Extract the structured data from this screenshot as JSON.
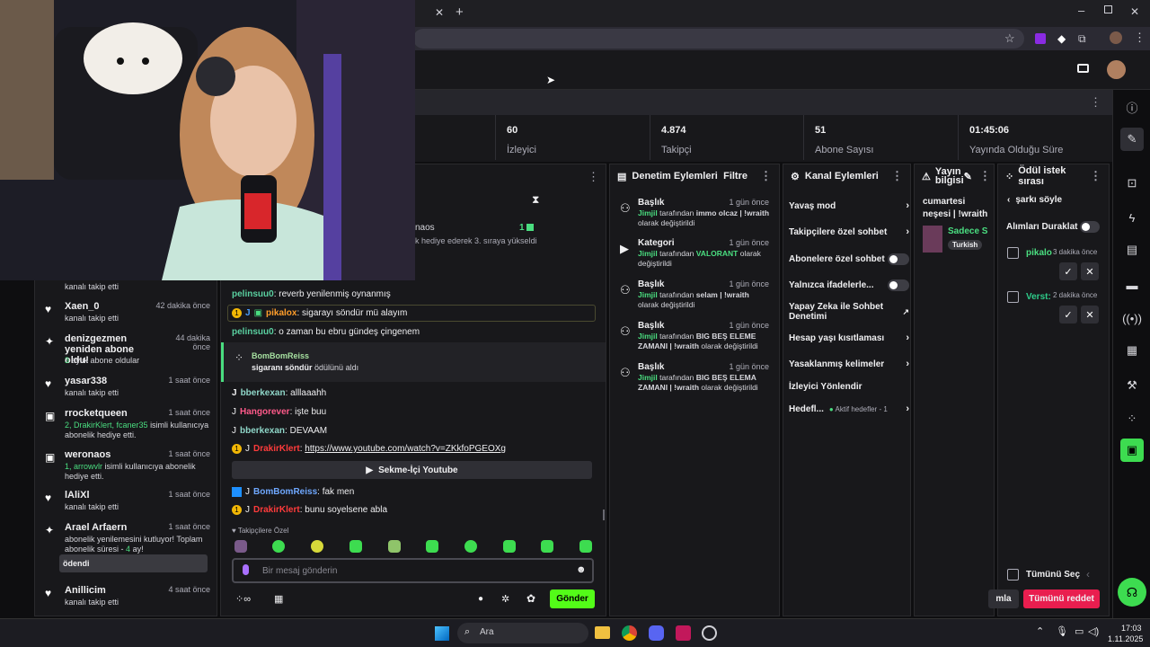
{
  "header": {
    "title": ""
  },
  "stats": [
    {
      "value": "60",
      "label": "İzleyici"
    },
    {
      "value": "4.874",
      "label": "Takipçi"
    },
    {
      "value": "51",
      "label": "Abone Sayısı"
    },
    {
      "value": "01:45:06",
      "label": "Yayında Olduğu Süre"
    }
  ],
  "feed": {
    "partial_top": "kanalı takip etti",
    "items": [
      {
        "name": "Xaen_0",
        "time": "42 dakika önce",
        "desc": "kanalı takip etti"
      },
      {
        "name": "denizgezmen yeniden abone oldu!",
        "time": "44 dakika önce",
        "desc_green": "3",
        "desc": "aylık abone oldular"
      },
      {
        "name": "yasar338",
        "time": "1 saat önce",
        "desc": "kanalı takip etti"
      },
      {
        "name": "rrocketqueen",
        "time": "1 saat önce",
        "desc_green": "2, DrakirKlert, fcaner35",
        "desc": "isimli kullanıcıya abonelik hediye etti."
      },
      {
        "name": "weronaos",
        "time": "1 saat önce",
        "desc_green": "1, arrowvlr",
        "desc": "isimli kullanıcıya abonelik hediye etti."
      },
      {
        "name": "lAliXl",
        "time": "1 saat önce",
        "desc": "kanalı takip etti"
      },
      {
        "name": "Arael Arfaern",
        "time": "1 saat önce",
        "desc": "abonelik yenilemesini kutluyor! Toplam abonelik süresi -",
        "desc_green": "4",
        "desc2": "ay!",
        "button": "ödendi"
      },
      {
        "name": "Anillicim",
        "time": "4 saat önce",
        "desc": "kanalı takip etti"
      }
    ]
  },
  "hype": {
    "name": "naos",
    "count": "1",
    "desc": "k hediye ederek 3. sıraya yükseldi"
  },
  "chat": {
    "lines": [
      {
        "user": "pelinsuu0",
        "msg": "reverb yenilenmiş oynanmış"
      },
      {
        "user": "pikalox",
        "msg": "sigarayı söndür mü alayım"
      },
      {
        "user": "pelinsuu0",
        "msg": "o zaman bu ebru gündeş çingenem"
      },
      {
        "user": "BomBomReiss",
        "msg": "sigaranı söndür",
        "suffix": "ödülünü aldı"
      },
      {
        "user": "bberkexan",
        "msg": "alllaaahh"
      },
      {
        "user": "Hangorever",
        "msg": "işte buu"
      },
      {
        "user": "bberkexan",
        "msg": "DEVAAM"
      },
      {
        "user": "DrakirKlert",
        "msg": "https://www.youtube.com/watch?v=ZKkfoPGEOXg"
      },
      {
        "user": "BomBomReiss",
        "msg": "fak men"
      },
      {
        "user": "DrakirKlert",
        "msg": "bunu soyelsene abla"
      }
    ],
    "youtube_button": "Sekme-İçi Youtube",
    "emote_category": "Takipçilere Özel",
    "input_placeholder": "Bir mesaj gönderin",
    "send_button": "Gönder"
  },
  "mod_log": {
    "title": "Denetim Eylemleri",
    "filter": "Filtre",
    "items": [
      {
        "title": "Başlık",
        "time": "1 gün önce",
        "actor": "Jimjil",
        "mid": "tarafından",
        "value": "immo olcaz | !wraith",
        "tail": "olarak değiştirildi"
      },
      {
        "title": "Kategori",
        "time": "1 gün önce",
        "actor": "Jimjil",
        "mid": "tarafından",
        "value": "VALORANT",
        "tail": "olarak değiştirildi"
      },
      {
        "title": "Başlık",
        "time": "1 gün önce",
        "actor": "Jimjil",
        "mid": "tarafından",
        "value": "selam | !wraith",
        "tail": "olarak değiştirildi"
      },
      {
        "title": "Başlık",
        "time": "1 gün önce",
        "actor": "Jimjil",
        "mid": "tarafından",
        "value": "BIG BEŞ ELEME ZAMANI | !wraith",
        "tail": "olarak değiştirildi"
      },
      {
        "title": "Başlık",
        "time": "1 gün önce",
        "actor": "Jimjil",
        "mid": "tarafından",
        "value": "BIG BEŞ ELEMA ZAMANI | !wraith",
        "tail": "olarak değiştirildi"
      }
    ]
  },
  "channel_actions": {
    "title": "Kanal Eylemleri",
    "items": [
      {
        "label": "Yavaş mod",
        "kind": "chevron"
      },
      {
        "label": "Takipçilere özel sohbet",
        "kind": "chevron"
      },
      {
        "label": "Abonelere özel sohbet",
        "kind": "toggle"
      },
      {
        "label": "Yalnızca ifadelerle...",
        "kind": "toggle"
      },
      {
        "label": "Yapay Zeka ile Sohbet Denetimi",
        "kind": "external"
      },
      {
        "label": "Hesap yaşı kısıtlaması",
        "kind": "chevron"
      },
      {
        "label": "Yasaklanmış kelimeler",
        "kind": "chevron"
      },
      {
        "label": "İzleyici Yönlendir",
        "kind": "none"
      },
      {
        "label": "Hedefl...",
        "kind": "goal",
        "extra": "Aktif hedefler - 1"
      }
    ]
  },
  "stream_info": {
    "title": "Yayın bilgisi",
    "stream_title": "cumartesi neşesi | !wraith",
    "game": "Sadece S",
    "tag": "Turkish"
  },
  "reward_queue": {
    "title": "Ödül istek sırası",
    "back_label": "şarkı söyle",
    "pause_label": "Alımları Duraklat",
    "items": [
      {
        "user": "pikalo",
        "time": "3 dakika önce"
      },
      {
        "user": "Verst:",
        "time": "2 dakika önce"
      }
    ],
    "select_all": "Tümünü Seç",
    "partial_btn": "mla",
    "reject_all": "Tümünü reddet"
  },
  "taskbar": {
    "search": "Ara",
    "time": "17:03",
    "date": "1.11.2025"
  }
}
